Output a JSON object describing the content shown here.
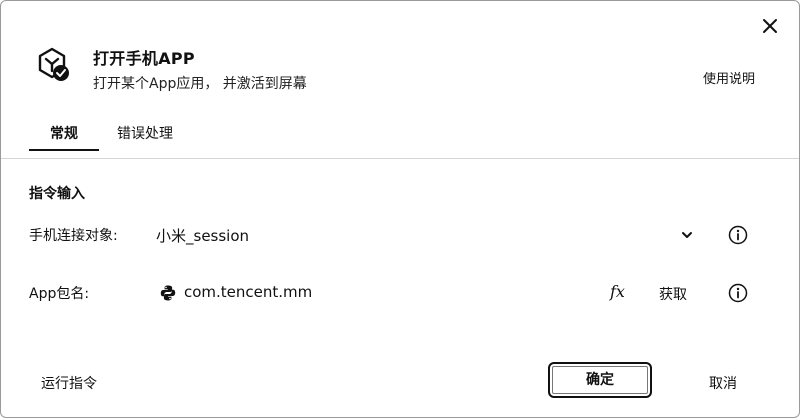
{
  "dialog": {
    "title": "打开手机APP",
    "subtitle": "打开某个App应用， 并激活到屏幕",
    "help_label": "使用说明",
    "icon": "app-hexagon-check-icon",
    "close_icon": "close-icon"
  },
  "tabs": [
    {
      "label": "常规",
      "active": true
    },
    {
      "label": "错误处理",
      "active": false
    }
  ],
  "section": {
    "title": "指令输入"
  },
  "fields": {
    "connection": {
      "label": "手机连接对象:",
      "value": "小米_session",
      "dropdown_icon": "chevron-down-icon",
      "info_icon": "info-icon"
    },
    "package": {
      "label": "App包名:",
      "value": "com.tencent.mm",
      "value_icon": "python-icon",
      "fx_label": "fx",
      "fetch_label": "获取",
      "info_icon": "info-icon"
    }
  },
  "footer": {
    "run_label": "运行指令",
    "confirm_label": "确定",
    "cancel_label": "取消"
  }
}
